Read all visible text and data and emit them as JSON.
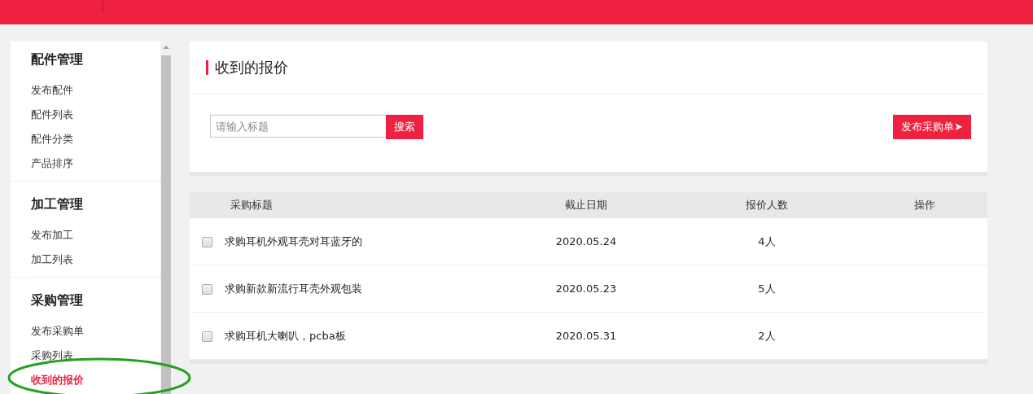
{
  "sidebar": {
    "groups": [
      {
        "title": "配件管理",
        "items": [
          {
            "label": "发布配件",
            "selected": false
          },
          {
            "label": "配件列表",
            "selected": false
          },
          {
            "label": "配件分类",
            "selected": false
          },
          {
            "label": "产品排序",
            "selected": false
          }
        ]
      },
      {
        "title": "加工管理",
        "items": [
          {
            "label": "发布加工",
            "selected": false
          },
          {
            "label": "加工列表",
            "selected": false
          }
        ]
      },
      {
        "title": "采购管理",
        "items": [
          {
            "label": "发布采购单",
            "selected": false
          },
          {
            "label": "采购列表",
            "selected": false
          },
          {
            "label": "收到的报价",
            "selected": true
          }
        ]
      }
    ]
  },
  "panel": {
    "title": "收到的报价",
    "search": {
      "placeholder": "请输入标题",
      "button": "搜索"
    },
    "publish_button": "发布采购单➤"
  },
  "table": {
    "columns": [
      "采购标题",
      "截止日期",
      "报价人数",
      "操作"
    ],
    "rows": [
      {
        "checked": false,
        "title": "求购耳机外观耳壳对耳蓝牙的",
        "deadline": "2020.05.24",
        "quotes": "4人"
      },
      {
        "checked": false,
        "title": "求购新款新流行耳壳外观包装",
        "deadline": "2020.05.23",
        "quotes": "5人"
      },
      {
        "checked": false,
        "title": "求购耳机大喇叭，pcba板",
        "deadline": "2020.05.31",
        "quotes": "2人"
      }
    ]
  }
}
